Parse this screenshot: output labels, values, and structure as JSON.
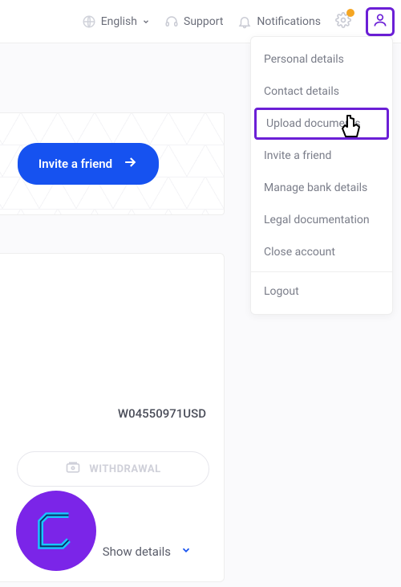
{
  "topbar": {
    "language": "English",
    "support": "Support",
    "notifications": "Notifications"
  },
  "dropdown": {
    "personal_details": "Personal details",
    "contact_details": "Contact details",
    "upload_documents": "Upload documents",
    "invite_friend": "Invite a friend",
    "manage_bank": "Manage bank details",
    "legal_docs": "Legal documentation",
    "close_account": "Close account",
    "logout": "Logout"
  },
  "invite": {
    "button_label": "Invite a friend"
  },
  "wallet": {
    "id": "W04550971USD",
    "withdraw_label": "WITHDRAWAL",
    "show_details": "Show details"
  }
}
